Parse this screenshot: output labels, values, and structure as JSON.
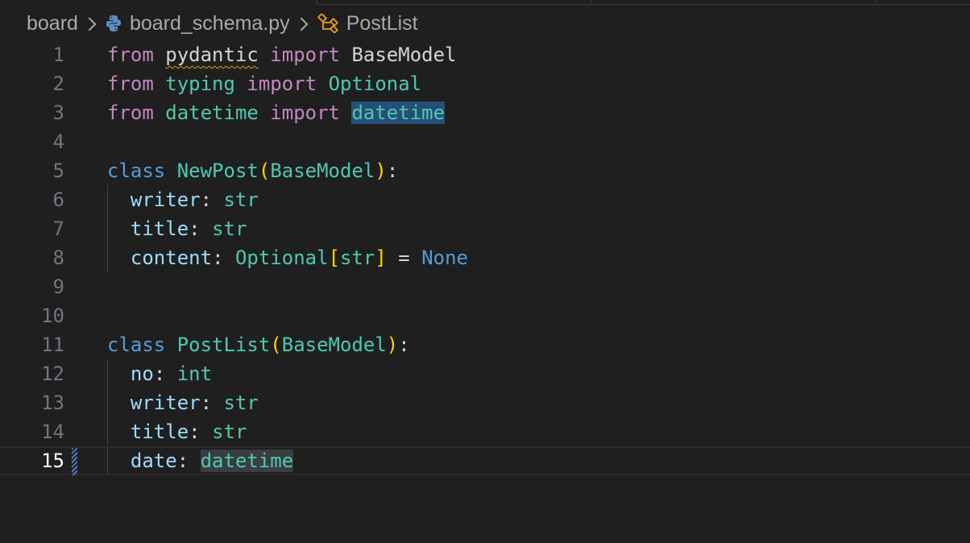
{
  "breadcrumb": {
    "folder": "board",
    "file": "board_schema.py",
    "symbol": "PostList"
  },
  "code": {
    "line_numbers": [
      "1",
      "2",
      "3",
      "4",
      "5",
      "6",
      "7",
      "8",
      "9",
      "10",
      "11",
      "12",
      "13",
      "14",
      "15"
    ],
    "tokens": {
      "l1_from": "from",
      "l1_mod": "pydantic",
      "l1_import": "import",
      "l1_name": "BaseModel",
      "l2_from": "from",
      "l2_mod": "typing",
      "l2_import": "import",
      "l2_name": "Optional",
      "l3_from": "from",
      "l3_mod": "datetime",
      "l3_import": "import",
      "l3_name": "datetime",
      "l5_class": "class",
      "l5_name": "NewPost",
      "l5_open": "(",
      "l5_base": "BaseModel",
      "l5_close": ")",
      "l5_colon": ":",
      "l6_var": "writer",
      "l6_colon": ":",
      "l6_type": "str",
      "l7_var": "title",
      "l7_colon": ":",
      "l7_type": "str",
      "l8_var": "content",
      "l8_colon": ":",
      "l8_type": "Optional",
      "l8_lb": "[",
      "l8_inner": "str",
      "l8_rb": "]",
      "l8_eq": "=",
      "l8_val": "None",
      "l11_class": "class",
      "l11_name": "PostList",
      "l11_open": "(",
      "l11_base": "BaseModel",
      "l11_close": ")",
      "l11_colon": ":",
      "l12_var": "no",
      "l12_colon": ":",
      "l12_type": "int",
      "l13_var": "writer",
      "l13_colon": ":",
      "l13_type": "str",
      "l14_var": "title",
      "l14_colon": ":",
      "l14_type": "str",
      "l15_var": "date",
      "l15_colon": ":",
      "l15_type": "datetime"
    }
  },
  "icons": {
    "file_type": "python-file-icon",
    "symbol_type": "class-symbol-icon",
    "separator": "chevron-right-icon"
  },
  "colors": {
    "background": "#1f1f1f",
    "keyword_import": "#c586c0",
    "keyword_class": "#569cd6",
    "type": "#4ec9b0",
    "variable": "#9cdcfe",
    "bracket": "#ffd700",
    "selection_highlight": "#264f78",
    "modified_gutter": "#4d78cc"
  }
}
